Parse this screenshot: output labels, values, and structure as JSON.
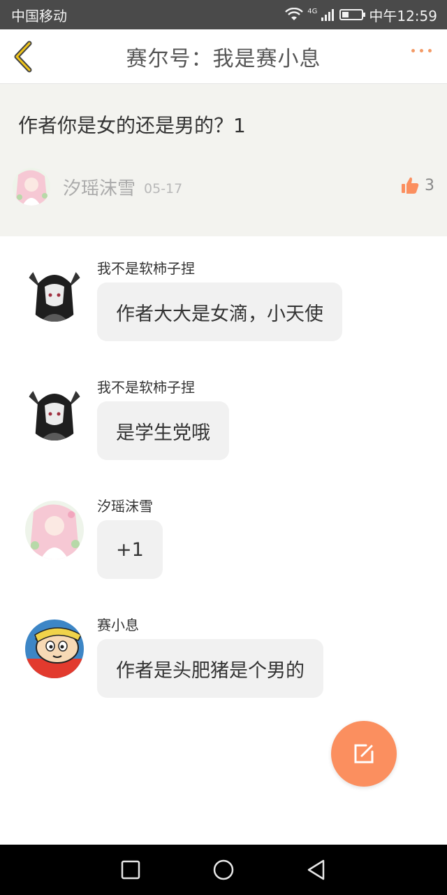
{
  "status_bar": {
    "carrier": "中国移动",
    "network": "4G",
    "battery_level": 0.35,
    "time": "中午12:59"
  },
  "header": {
    "title": "赛尔号：我是赛小息",
    "back_icon": "chevron-left-icon",
    "more_icon": "more-dots-icon",
    "accent_color": "#f39a66"
  },
  "post": {
    "content": "作者你是女的还是男的？1",
    "author": "汐瑶沫雪",
    "date": "05-17",
    "likes": "3",
    "like_icon": "thumbs-up-icon",
    "like_color": "#fb8f5f"
  },
  "comments": [
    {
      "author": "我不是软柿子捏",
      "text": "作者大大是女滴，小天使",
      "avatar": "dark-haired-girl-avatar"
    },
    {
      "author": "我不是软柿子捏",
      "text": "是学生党哦",
      "avatar": "dark-haired-girl-avatar"
    },
    {
      "author": "汐瑶沫雪",
      "text": "+1",
      "avatar": "pink-haired-girl-avatar"
    },
    {
      "author": "赛小息",
      "text": "作者是头肥猪是个男的",
      "avatar": "cartoon-boy-avatar"
    }
  ],
  "fab": {
    "icon": "edit-icon",
    "color": "#fb8f5f"
  },
  "nav_bar": {
    "recent_icon": "square-icon",
    "home_icon": "circle-icon",
    "back_icon": "triangle-back-icon"
  }
}
